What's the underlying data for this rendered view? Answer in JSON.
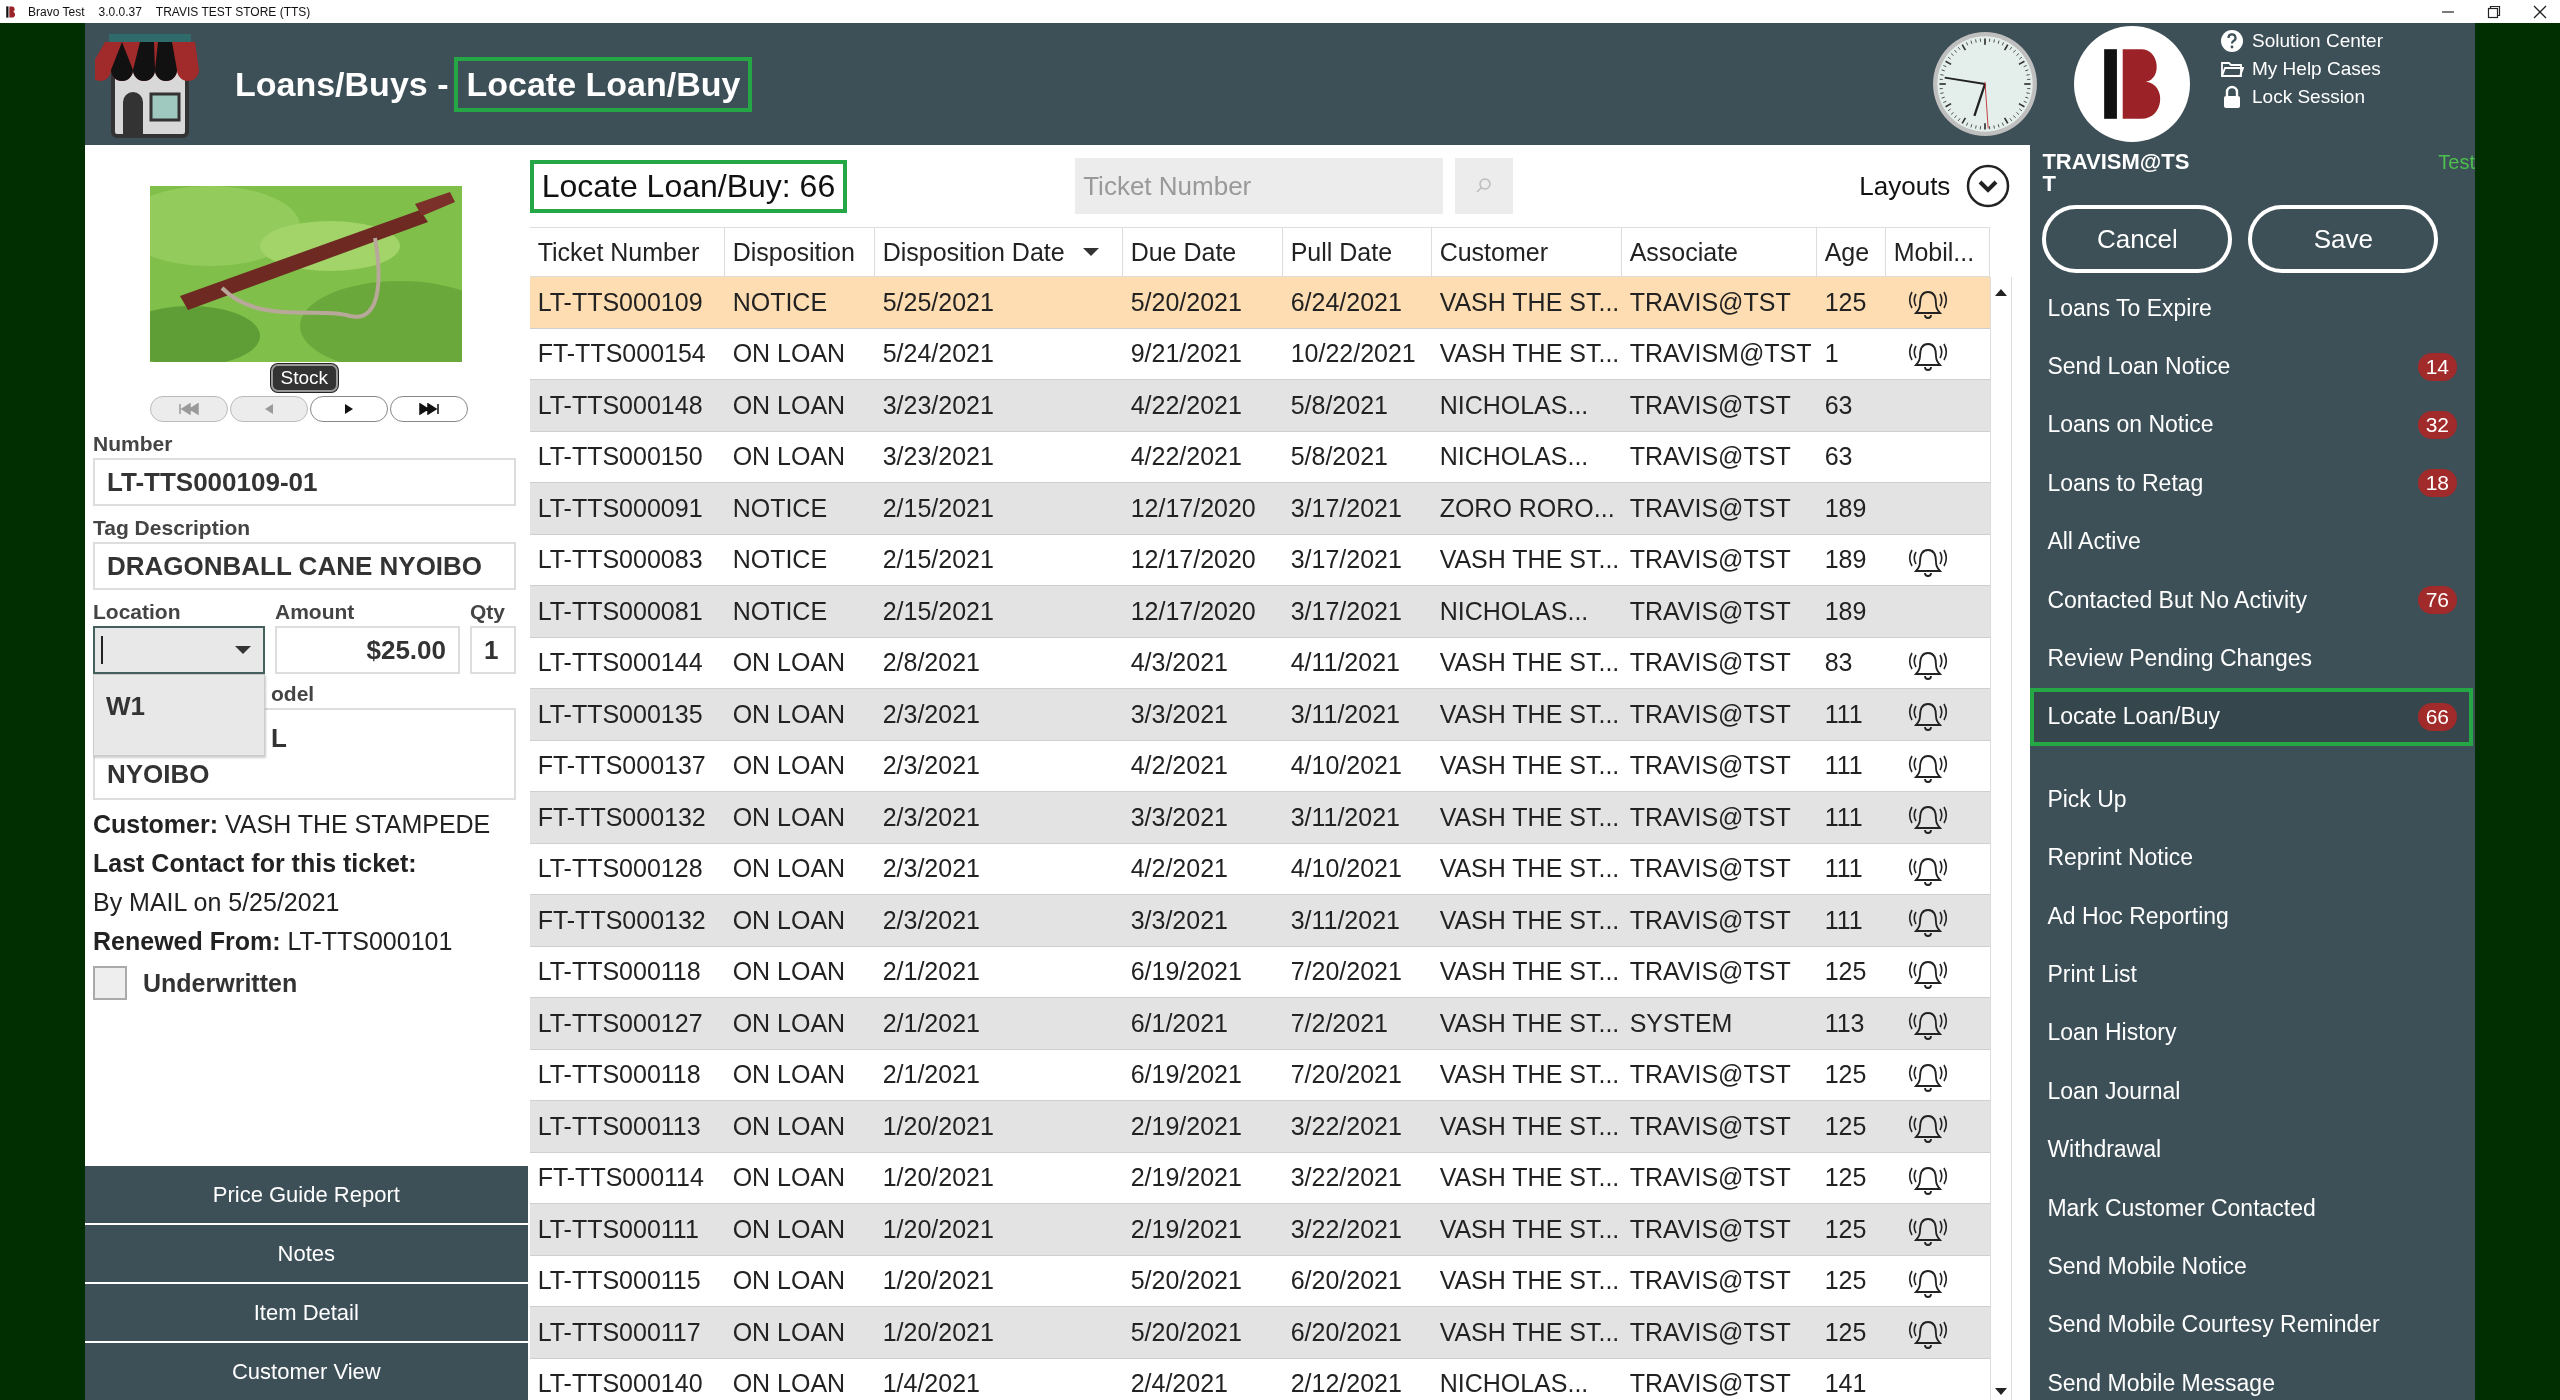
{
  "titlebar": {
    "app": "Bravo Test",
    "version": "3.0.0.37",
    "store": "TRAVIS TEST STORE (TTS)"
  },
  "header": {
    "section": "Loans/Buys -",
    "page": "Locate Loan/Buy",
    "help_links": [
      {
        "kind": "help",
        "label": "Solution Center"
      },
      {
        "kind": "folder",
        "label": "My Help Cases"
      },
      {
        "kind": "lock",
        "label": "Lock Session"
      }
    ]
  },
  "item_panel": {
    "stock_label": "Stock",
    "nav_buttons": [
      {
        "kind": "first",
        "disabled": true
      },
      {
        "kind": "prev",
        "disabled": true
      },
      {
        "kind": "next",
        "disabled": false
      },
      {
        "kind": "last",
        "disabled": false
      }
    ],
    "number": {
      "label": "Number",
      "value": "LT-TTS000109-01"
    },
    "tag_description": {
      "label": "Tag Description",
      "value": "DRAGONBALL CANE NYOIBO"
    },
    "location": {
      "label": "Location",
      "expanded": true,
      "options": [
        "W1"
      ]
    },
    "amount": {
      "label": "Amount",
      "value": "$25.00"
    },
    "qty": {
      "label": "Qty",
      "value": "1"
    },
    "model": {
      "label": "odel",
      "value_lines": [
        "L",
        "NYOIBO"
      ]
    },
    "customer": "**Customer:** VASH THE STAMPEDE",
    "last_contact_label": "Last Contact for this ticket:",
    "last_contact": "By MAIL on 5/25/2021",
    "renewed": "**Renewed From:** LT-TTS000101",
    "underwritten": {
      "label": "Underwritten",
      "checked": false
    },
    "bottom_buttons": [
      "Price Guide Report",
      "Notes",
      "Item Detail",
      "Customer View"
    ]
  },
  "list": {
    "title": "Locate Loan/Buy: 66",
    "search": {
      "placeholder": "Ticket Number"
    },
    "layouts": "Layouts",
    "columns": [
      {
        "label": "Ticket Number",
        "sorted": false
      },
      {
        "label": "Disposition",
        "sorted": false
      },
      {
        "label": "Disposition Date",
        "sorted": true
      },
      {
        "label": "Due Date",
        "sorted": false
      },
      {
        "label": "Pull Date",
        "sorted": false
      },
      {
        "label": "Customer",
        "sorted": false
      },
      {
        "label": "Associate",
        "sorted": false
      },
      {
        "label": "Age",
        "sorted": false
      },
      {
        "label": "Mobil...",
        "sorted": false
      }
    ],
    "rows": [
      {
        "cells": [
          "LT-TTS000109",
          "NOTICE",
          "5/25/2021",
          "5/20/2021",
          "6/24/2021",
          "VASH THE ST...",
          "TRAVIS@TST",
          "125"
        ],
        "mobile_alert": true,
        "selected": true
      },
      {
        "cells": [
          "FT-TTS000154",
          "ON LOAN",
          "5/24/2021",
          "9/21/2021",
          "10/22/2021",
          "VASH THE ST...",
          "TRAVISM@TST",
          "1"
        ],
        "mobile_alert": true,
        "selected": false
      },
      {
        "cells": [
          "LT-TTS000148",
          "ON LOAN",
          "3/23/2021",
          "4/22/2021",
          "5/8/2021",
          "NICHOLAS...",
          "TRAVIS@TST",
          "63"
        ],
        "mobile_alert": false,
        "selected": false
      },
      {
        "cells": [
          "LT-TTS000150",
          "ON LOAN",
          "3/23/2021",
          "4/22/2021",
          "5/8/2021",
          "NICHOLAS...",
          "TRAVIS@TST",
          "63"
        ],
        "mobile_alert": false,
        "selected": false
      },
      {
        "cells": [
          "LT-TTS000091",
          "NOTICE",
          "2/15/2021",
          "12/17/2020",
          "3/17/2021",
          "ZORO RORO...",
          "TRAVIS@TST",
          "189"
        ],
        "mobile_alert": false,
        "selected": false
      },
      {
        "cells": [
          "LT-TTS000083",
          "NOTICE",
          "2/15/2021",
          "12/17/2020",
          "3/17/2021",
          "VASH THE ST...",
          "TRAVIS@TST",
          "189"
        ],
        "mobile_alert": true,
        "selected": false
      },
      {
        "cells": [
          "LT-TTS000081",
          "NOTICE",
          "2/15/2021",
          "12/17/2020",
          "3/17/2021",
          "NICHOLAS...",
          "TRAVIS@TST",
          "189"
        ],
        "mobile_alert": false,
        "selected": false
      },
      {
        "cells": [
          "LT-TTS000144",
          "ON LOAN",
          "2/8/2021",
          "4/3/2021",
          "4/11/2021",
          "VASH THE ST...",
          "TRAVIS@TST",
          "83"
        ],
        "mobile_alert": true,
        "selected": false
      },
      {
        "cells": [
          "LT-TTS000135",
          "ON LOAN",
          "2/3/2021",
          "3/3/2021",
          "3/11/2021",
          "VASH THE ST...",
          "TRAVIS@TST",
          "111"
        ],
        "mobile_alert": true,
        "selected": false
      },
      {
        "cells": [
          "FT-TTS000137",
          "ON LOAN",
          "2/3/2021",
          "4/2/2021",
          "4/10/2021",
          "VASH THE ST...",
          "TRAVIS@TST",
          "111"
        ],
        "mobile_alert": true,
        "selected": false
      },
      {
        "cells": [
          "FT-TTS000132",
          "ON LOAN",
          "2/3/2021",
          "3/3/2021",
          "3/11/2021",
          "VASH THE ST...",
          "TRAVIS@TST",
          "111"
        ],
        "mobile_alert": true,
        "selected": false
      },
      {
        "cells": [
          "LT-TTS000128",
          "ON LOAN",
          "2/3/2021",
          "4/2/2021",
          "4/10/2021",
          "VASH THE ST...",
          "TRAVIS@TST",
          "111"
        ],
        "mobile_alert": true,
        "selected": false
      },
      {
        "cells": [
          "FT-TTS000132",
          "ON LOAN",
          "2/3/2021",
          "3/3/2021",
          "3/11/2021",
          "VASH THE ST...",
          "TRAVIS@TST",
          "111"
        ],
        "mobile_alert": true,
        "selected": false
      },
      {
        "cells": [
          "LT-TTS000118",
          "ON LOAN",
          "2/1/2021",
          "6/19/2021",
          "7/20/2021",
          "VASH THE ST...",
          "TRAVIS@TST",
          "125"
        ],
        "mobile_alert": true,
        "selected": false
      },
      {
        "cells": [
          "LT-TTS000127",
          "ON LOAN",
          "2/1/2021",
          "6/1/2021",
          "7/2/2021",
          "VASH THE ST...",
          "SYSTEM",
          "113"
        ],
        "mobile_alert": true,
        "selected": false
      },
      {
        "cells": [
          "LT-TTS000118",
          "ON LOAN",
          "2/1/2021",
          "6/19/2021",
          "7/20/2021",
          "VASH THE ST...",
          "TRAVIS@TST",
          "125"
        ],
        "mobile_alert": true,
        "selected": false
      },
      {
        "cells": [
          "LT-TTS000113",
          "ON LOAN",
          "1/20/2021",
          "2/19/2021",
          "3/22/2021",
          "VASH THE ST...",
          "TRAVIS@TST",
          "125"
        ],
        "mobile_alert": true,
        "selected": false
      },
      {
        "cells": [
          "FT-TTS000114",
          "ON LOAN",
          "1/20/2021",
          "2/19/2021",
          "3/22/2021",
          "VASH THE ST...",
          "TRAVIS@TST",
          "125"
        ],
        "mobile_alert": true,
        "selected": false
      },
      {
        "cells": [
          "LT-TTS000111",
          "ON LOAN",
          "1/20/2021",
          "2/19/2021",
          "3/22/2021",
          "VASH THE ST...",
          "TRAVIS@TST",
          "125"
        ],
        "mobile_alert": true,
        "selected": false
      },
      {
        "cells": [
          "LT-TTS000115",
          "ON LOAN",
          "1/20/2021",
          "5/20/2021",
          "6/20/2021",
          "VASH THE ST...",
          "TRAVIS@TST",
          "125"
        ],
        "mobile_alert": true,
        "selected": false
      },
      {
        "cells": [
          "LT-TTS000117",
          "ON LOAN",
          "1/20/2021",
          "5/20/2021",
          "6/20/2021",
          "VASH THE ST...",
          "TRAVIS@TST",
          "125"
        ],
        "mobile_alert": true,
        "selected": false
      },
      {
        "cells": [
          "LT-TTS000140",
          "ON LOAN",
          "1/4/2021",
          "2/4/2021",
          "2/12/2021",
          "NICHOLAS...",
          "TRAVIS@TST",
          "141"
        ],
        "mobile_alert": false,
        "selected": false
      }
    ]
  },
  "sidebar": {
    "user": "TRAVISM@TST",
    "env_label": "Test",
    "buttons": [
      "Cancel",
      "Save"
    ],
    "groups": [
      [
        {
          "label": "Loans To Expire",
          "selected": false
        },
        {
          "label": "Send Loan Notice",
          "count": "14",
          "selected": false
        },
        {
          "label": "Loans on Notice",
          "count": "32",
          "selected": false
        },
        {
          "label": "Loans to Retag",
          "count": "18",
          "selected": false
        },
        {
          "label": "All Active",
          "selected": false
        },
        {
          "label": "Contacted But No Activity",
          "count": "76",
          "selected": false
        },
        {
          "label": "Review Pending Changes",
          "selected": false
        },
        {
          "label": "Locate Loan/Buy",
          "count": "66",
          "selected": true
        }
      ],
      [
        {
          "label": "Pick Up",
          "selected": false
        },
        {
          "label": "Reprint Notice",
          "selected": false
        },
        {
          "label": "Ad Hoc Reporting",
          "selected": false
        },
        {
          "label": "Print List",
          "selected": false
        },
        {
          "label": "Loan History",
          "selected": false
        },
        {
          "label": "Loan Journal",
          "selected": false
        },
        {
          "label": "Withdrawal",
          "selected": false
        },
        {
          "label": "Mark Customer Contacted",
          "selected": false
        },
        {
          "label": "Send Mobile Notice",
          "selected": false
        },
        {
          "label": "Send Mobile Courtesy Reminder",
          "selected": false
        },
        {
          "label": "Send Mobile Message",
          "selected": false
        }
      ]
    ]
  }
}
